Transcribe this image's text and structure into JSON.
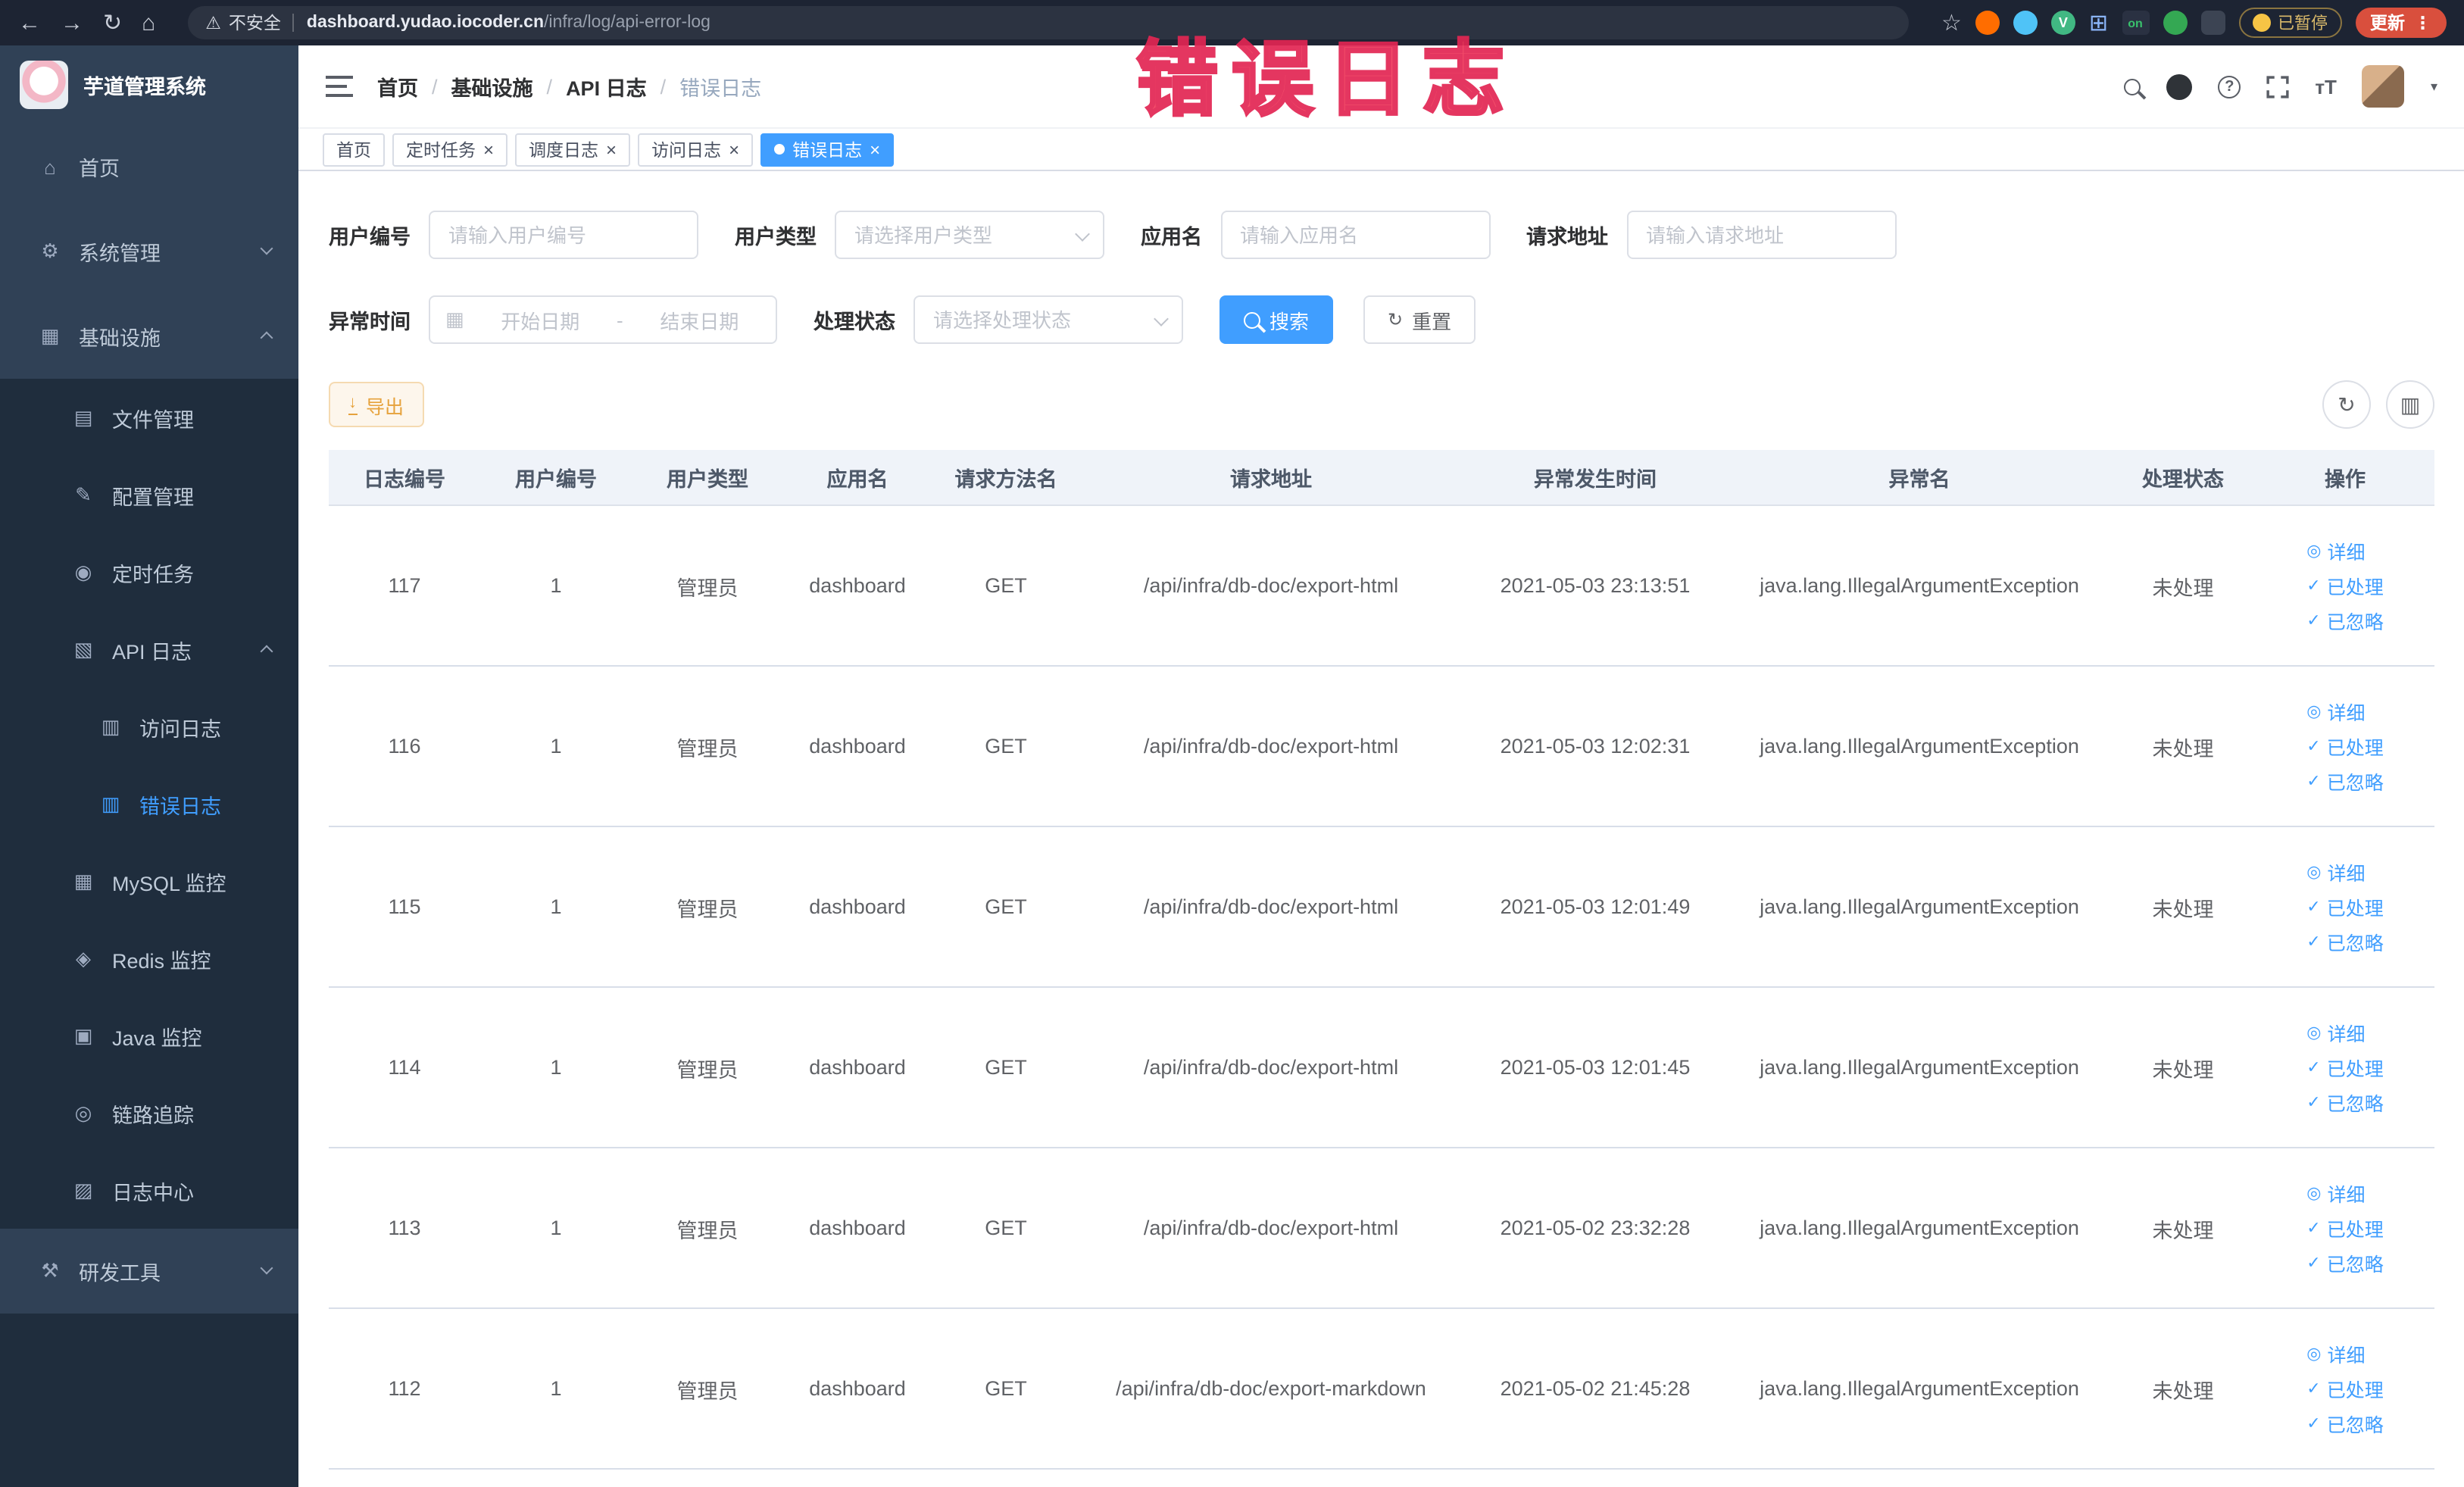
{
  "browser": {
    "security_label": "不安全",
    "url_host": "dashboard.yudao.iocoder.cn",
    "url_path": "/infra/log/api-error-log",
    "on_badge": "on",
    "paused_badge": "已暂停",
    "update_label": "更新"
  },
  "annotation": "错误日志",
  "sidebar": {
    "title": "芋道管理系统",
    "menu": [
      {
        "label": "首页",
        "icon": "home",
        "level": 1
      },
      {
        "label": "系统管理",
        "icon": "gear",
        "level": 1,
        "chevron": "down"
      },
      {
        "label": "基础设施",
        "icon": "infra",
        "level": 1,
        "chevron": "up"
      },
      {
        "label": "文件管理",
        "icon": "file",
        "level": 2
      },
      {
        "label": "配置管理",
        "icon": "config",
        "level": 2
      },
      {
        "label": "定时任务",
        "icon": "job",
        "level": 2
      },
      {
        "label": "API 日志",
        "icon": "apilog",
        "level": 2,
        "chevron": "up"
      },
      {
        "label": "访问日志",
        "icon": "accesslog",
        "level": 3
      },
      {
        "label": "错误日志",
        "icon": "errorlog",
        "level": 3,
        "active": true
      },
      {
        "label": "MySQL 监控",
        "icon": "mysql",
        "level": 2
      },
      {
        "label": "Redis 监控",
        "icon": "redis",
        "level": 2
      },
      {
        "label": "Java 监控",
        "icon": "java",
        "level": 2
      },
      {
        "label": "链路追踪",
        "icon": "trace",
        "level": 2
      },
      {
        "label": "日志中心",
        "icon": "logcenter",
        "level": 2
      },
      {
        "label": "研发工具",
        "icon": "devtools",
        "level": 1,
        "chevron": "down"
      }
    ]
  },
  "breadcrumb": [
    "首页",
    "基础设施",
    "API 日志",
    "错误日志"
  ],
  "breadcrumb_separator": "/",
  "tabs": [
    {
      "label": "首页",
      "closable": false,
      "active": false
    },
    {
      "label": "定时任务",
      "closable": true,
      "active": false
    },
    {
      "label": "调度日志",
      "closable": true,
      "active": false
    },
    {
      "label": "访问日志",
      "closable": true,
      "active": false
    },
    {
      "label": "错误日志",
      "closable": true,
      "active": true
    }
  ],
  "filters": {
    "user_id": {
      "label": "用户编号",
      "placeholder": "请输入用户编号"
    },
    "user_type": {
      "label": "用户类型",
      "placeholder": "请选择用户类型"
    },
    "app_name": {
      "label": "应用名",
      "placeholder": "请输入应用名"
    },
    "request_url": {
      "label": "请求地址",
      "placeholder": "请输入请求地址"
    },
    "exception_time": {
      "label": "异常时间",
      "start_placeholder": "开始日期",
      "separator": "-",
      "end_placeholder": "结束日期"
    },
    "process_status": {
      "label": "处理状态",
      "placeholder": "请选择处理状态"
    },
    "search_button": "搜索",
    "reset_button": "重置"
  },
  "toolbar": {
    "export_button": "导出"
  },
  "table": {
    "columns": [
      "日志编号",
      "用户编号",
      "用户类型",
      "应用名",
      "请求方法名",
      "请求地址",
      "异常发生时间",
      "异常名",
      "处理状态",
      "操作"
    ],
    "actions": [
      {
        "key": "detail",
        "label": "详细",
        "icon": "eye"
      },
      {
        "key": "processed",
        "label": "已处理",
        "icon": "check"
      },
      {
        "key": "ignored",
        "label": "已忽略",
        "icon": "check"
      }
    ],
    "rows": [
      {
        "id": "117",
        "user_id": "1",
        "user_type": "管理员",
        "app": "dashboard",
        "method": "GET",
        "url": "/api/infra/db-doc/export-html",
        "time": "2021-05-03 23:13:51",
        "exception": "java.lang.IllegalArgumentException",
        "status": "未处理"
      },
      {
        "id": "116",
        "user_id": "1",
        "user_type": "管理员",
        "app": "dashboard",
        "method": "GET",
        "url": "/api/infra/db-doc/export-html",
        "time": "2021-05-03 12:02:31",
        "exception": "java.lang.IllegalArgumentException",
        "status": "未处理"
      },
      {
        "id": "115",
        "user_id": "1",
        "user_type": "管理员",
        "app": "dashboard",
        "method": "GET",
        "url": "/api/infra/db-doc/export-html",
        "time": "2021-05-03 12:01:49",
        "exception": "java.lang.IllegalArgumentException",
        "status": "未处理"
      },
      {
        "id": "114",
        "user_id": "1",
        "user_type": "管理员",
        "app": "dashboard",
        "method": "GET",
        "url": "/api/infra/db-doc/export-html",
        "time": "2021-05-03 12:01:45",
        "exception": "java.lang.IllegalArgumentException",
        "status": "未处理"
      },
      {
        "id": "113",
        "user_id": "1",
        "user_type": "管理员",
        "app": "dashboard",
        "method": "GET",
        "url": "/api/infra/db-doc/export-html",
        "time": "2021-05-02 23:32:28",
        "exception": "java.lang.IllegalArgumentException",
        "status": "未处理"
      },
      {
        "id": "112",
        "user_id": "1",
        "user_type": "管理员",
        "app": "dashboard",
        "method": "GET",
        "url": "/api/infra/db-doc/export-markdown",
        "time": "2021-05-02 21:45:28",
        "exception": "java.lang.IllegalArgumentException",
        "status": "未处理"
      }
    ]
  }
}
